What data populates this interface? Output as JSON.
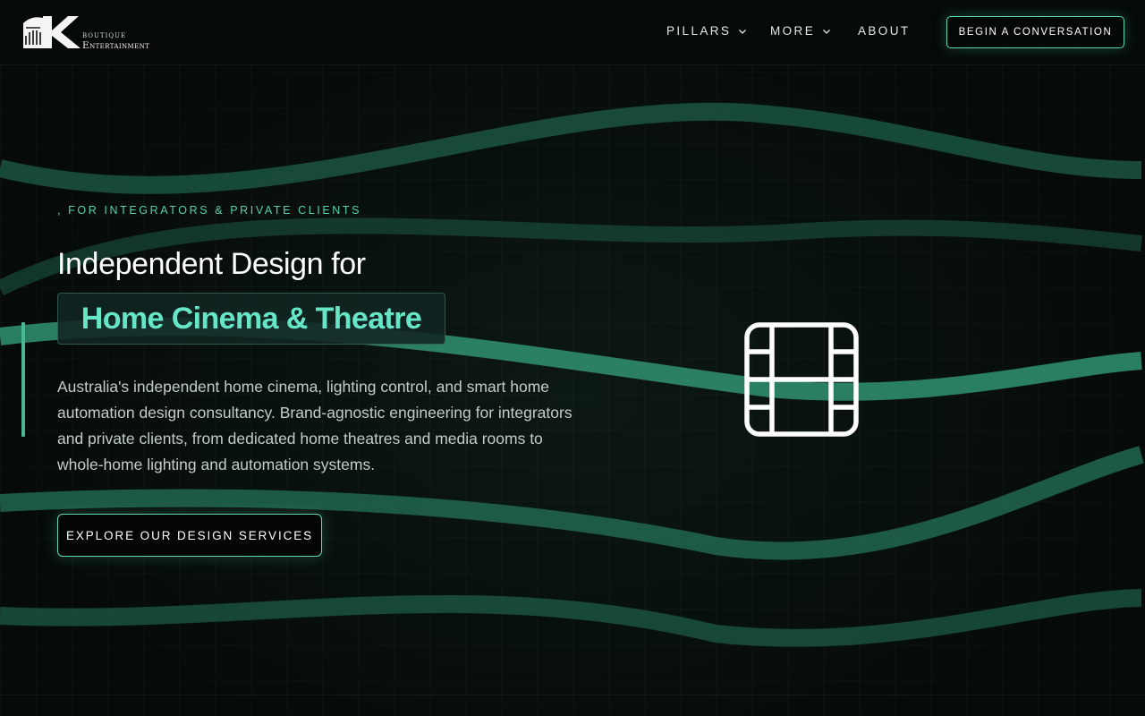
{
  "brand": {
    "small_text": "BOUTIQUE",
    "wordmark": "Entertainment"
  },
  "nav": {
    "items": [
      {
        "label": "PILLARS",
        "has_dropdown": true
      },
      {
        "label": "MORE",
        "has_dropdown": true
      },
      {
        "label": "ABOUT",
        "has_dropdown": false
      }
    ],
    "cta_label": "BEGIN A CONVERSATION"
  },
  "hero": {
    "eyebrow": ", FOR INTEGRATORS & PRIVATE CLIENTS",
    "headline": "Independent Design for",
    "highlight": "Home Cinema & Theatre",
    "description": "Australia's independent home cinema, lighting control, and smart home automation design consultancy. Brand-agnostic engineering for integrators and private clients, from dedicated home theatres and media rooms to whole-home lighting and automation systems.",
    "cta_label": "EXPLORE OUR DESIGN SERVICES",
    "icon": "film-icon"
  },
  "colors": {
    "accent": "#66e6c6",
    "accent_border": "#5fd6b6",
    "wave": "#2a8c6b",
    "background": "#060b09"
  }
}
